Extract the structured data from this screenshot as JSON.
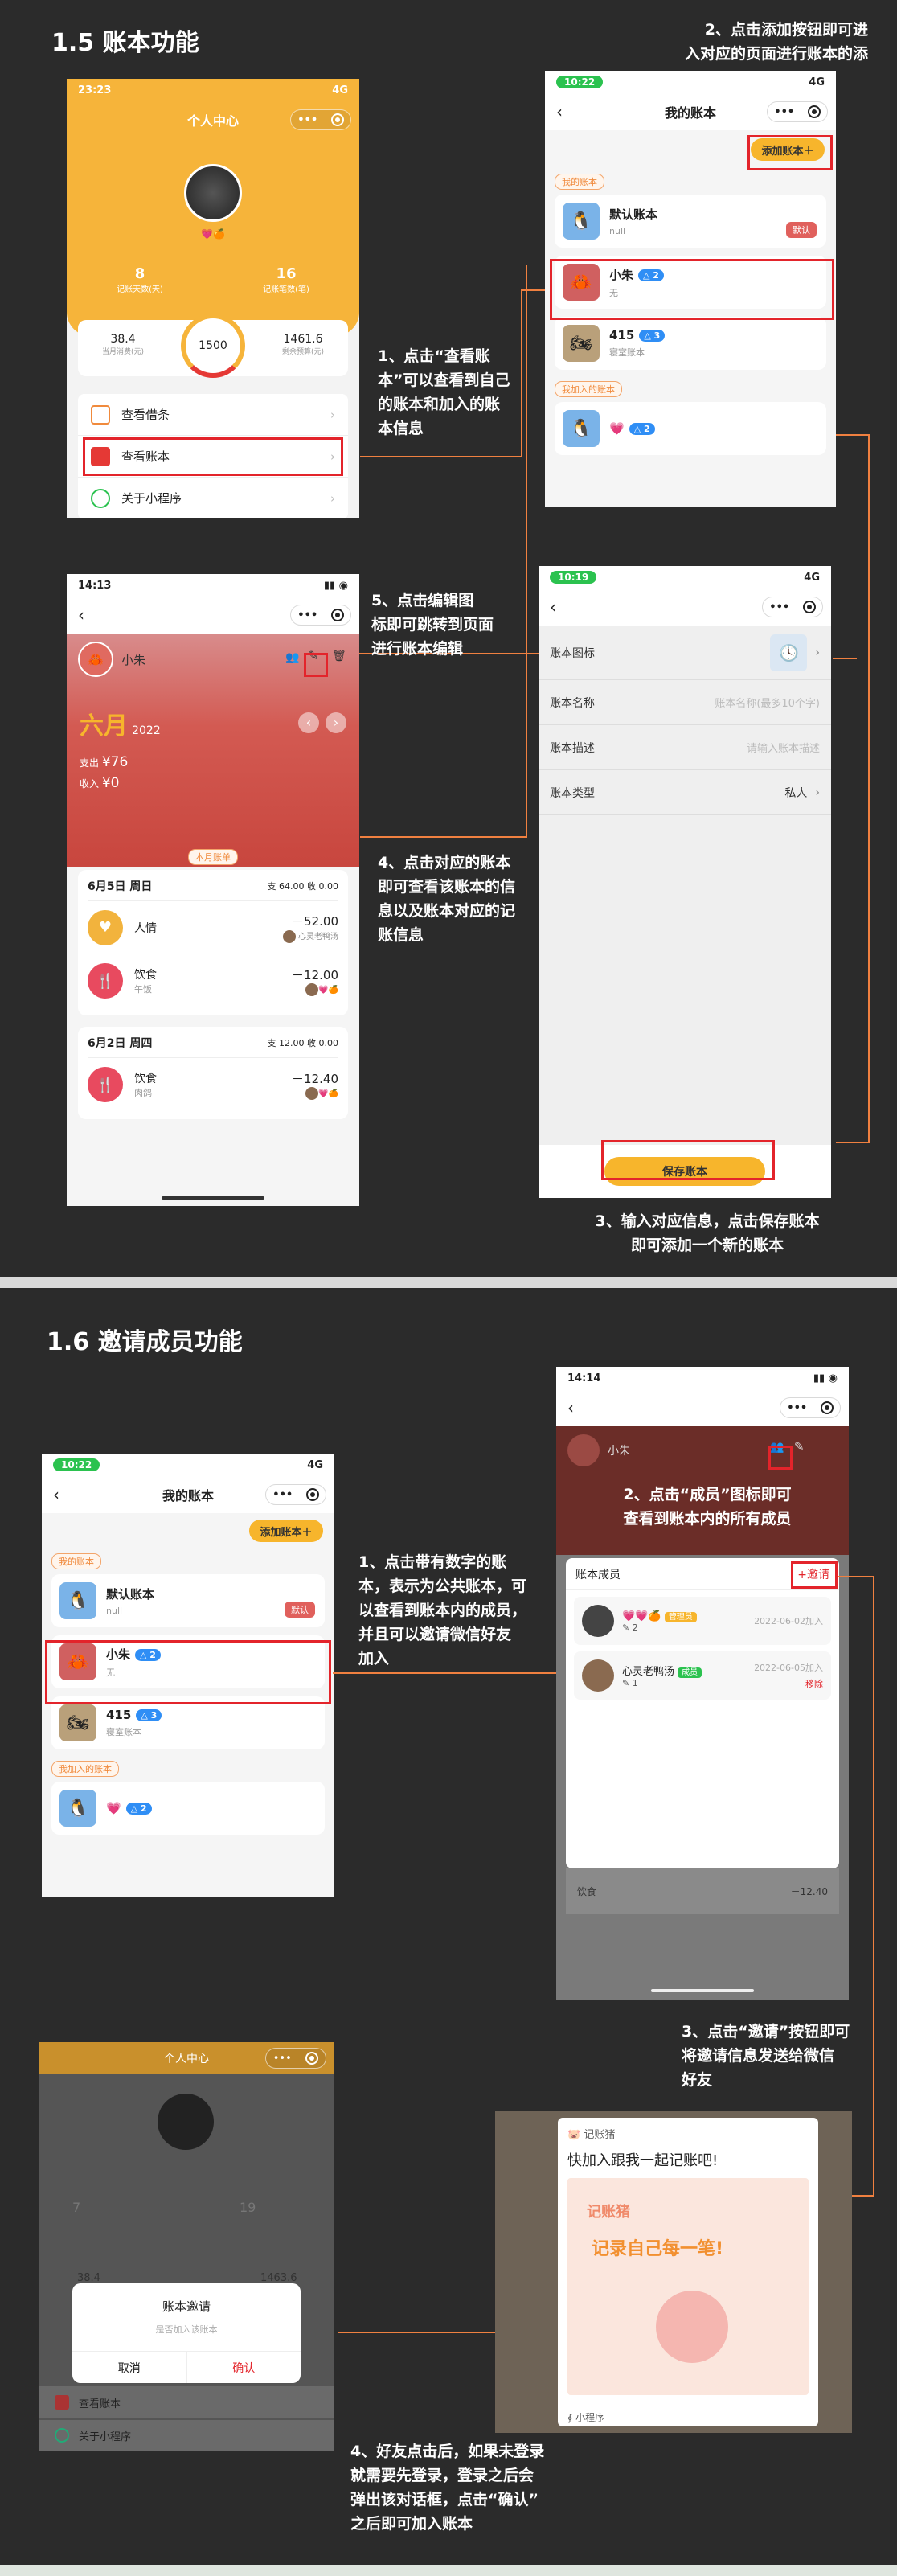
{
  "sections": {
    "s15_title": "1.5  账本功能",
    "s16_title": "1.6  邀请成员功能"
  },
  "notes": {
    "n1": [
      "1、点击“查看账",
      "本”可以查看到自己",
      "的账本和加入的账",
      "本信息"
    ],
    "n2": [
      "2、点击添加按钮即可进",
      "入对应的页面进行账本的添"
    ],
    "n3": [
      "3、输入对应信息，点击保存账本",
      "即可添加一个新的账本"
    ],
    "n4": [
      "4、点击对应的账本",
      "即可查看该账本的信",
      "息以及账本对应的记",
      "账信息"
    ],
    "n5": [
      "5、点击编辑图",
      "标即可跳转到页面",
      "进行账本编辑"
    ],
    "m1": [
      "1、点击带有数字的账",
      "本，表示为公共账本，可",
      "以查看到账本内的成员，",
      "并且可以邀请微信好友",
      "加入"
    ],
    "m2": [
      "2、点击“成员”图标即可",
      "查看到账本内的所有成员"
    ],
    "m3": [
      "3、点击“邀请”按钮即可",
      "将邀请信息发送给微信",
      "好友"
    ],
    "m4": [
      "4、好友点击后，如果未登录",
      "就需要先登录，登录之后会",
      "弹出该对话框，点击“确认”",
      "之后即可加入账本"
    ]
  },
  "profile": {
    "time": "23:23",
    "signal": "4G",
    "title": "个人中心",
    "count_left": "8",
    "count_left_label": "记账天数(天)",
    "count_right": "16",
    "count_right_label": "记账笔数(笔)",
    "amount_left": "38.4",
    "amount_left_label": "当月消费(元)",
    "center_value": "1500",
    "amount_right": "1461.6",
    "amount_right_label": "剩余预算(元)",
    "menu": [
      "查看借条",
      "查看账本",
      "关于小程序"
    ]
  },
  "books": {
    "time": "10:22",
    "signal": "4G",
    "title": "我的账本",
    "add_label": "添加账本＋",
    "my_tag": "我的账本",
    "joined_tag": "我加入的账本",
    "items": [
      {
        "name": "默认账本",
        "sub": "null",
        "badge": "默认"
      },
      {
        "name": "小朱",
        "count": "△ 2",
        "sub": "无"
      },
      {
        "name": "415",
        "count": "△ 3",
        "sub": "寝室账本"
      }
    ],
    "joined": [
      {
        "name": "💗",
        "count": "△ 2"
      }
    ]
  },
  "detail": {
    "time": "14:13",
    "book_name": "小朱",
    "month": "六月",
    "year": "2022",
    "expense_label": "支出",
    "expense": "¥76",
    "income_label": "收入",
    "income": "¥0",
    "month_tag": "本月账单",
    "days": [
      {
        "date": "6月5日  周日",
        "out": "支 64.00",
        "in": "收 0.00",
        "rows": [
          {
            "cat": "人情",
            "note": "",
            "amt": "－52.00",
            "who": "心灵老鸭汤"
          },
          {
            "cat": "饮食",
            "note": "午饭",
            "amt": "－12.00",
            "who": ""
          }
        ]
      },
      {
        "date": "6月2日  周四",
        "out": "支 12.00",
        "in": "收 0.00",
        "rows": [
          {
            "cat": "饮食",
            "note": "肉鸽",
            "amt": "－12.40",
            "who": ""
          }
        ]
      }
    ]
  },
  "form": {
    "time": "10:19",
    "signal": "4G",
    "rows": [
      {
        "label": "账本图标",
        "value": ""
      },
      {
        "label": "账本名称",
        "value": "账本名称(最多10个字)"
      },
      {
        "label": "账本描述",
        "value": "请输入账本描述"
      },
      {
        "label": "账本类型",
        "value": "私人"
      }
    ],
    "save_label": "保存账本"
  },
  "members": {
    "time": "14:14",
    "book_name": "小朱",
    "panel_title": "账本成员",
    "invite_label": "+邀请",
    "list": [
      {
        "name": "💗💗🍊",
        "tag": "管理员",
        "count": "2",
        "date": "2022-06-02加入",
        "action": ""
      },
      {
        "name": "心灵老鸭汤",
        "tag": "成员",
        "count": "1",
        "date": "2022-06-05加入",
        "action": "移除"
      }
    ],
    "peek_amt": "－12.40",
    "peek_cat": "饮食"
  },
  "share": {
    "app_name": "记账猪",
    "title": "快加入跟我一起记账吧!",
    "art1": "记账猪",
    "art2": "记录自己每一笔!",
    "footer": "小程序"
  },
  "dialog": {
    "title": "账本邀请",
    "sub": "是否加入该账本",
    "cancel": "取消",
    "confirm": "确认",
    "menu1": "查看账本",
    "menu2": "关于小程序",
    "bg_left": "7",
    "bg_right": "19",
    "bg_amt_l": "38.4",
    "bg_amt_r": "1463.6"
  },
  "colors": {
    "accent": "#f7b52c",
    "arrow": "#f08040",
    "highlight": "#e3242b"
  }
}
